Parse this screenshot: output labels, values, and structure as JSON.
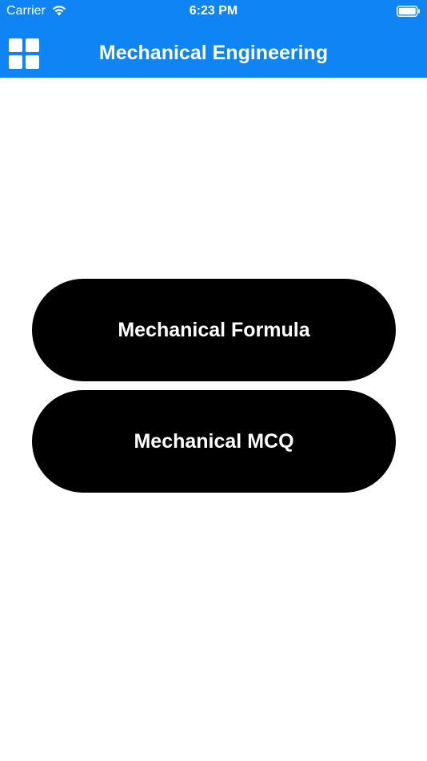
{
  "status_bar": {
    "carrier": "Carrier",
    "time": "6:23 PM",
    "icons": [
      "wifi-icon",
      "battery-icon"
    ]
  },
  "nav_bar": {
    "title": "Mechanical Engineering",
    "menu_icon": "grid-icon"
  },
  "main": {
    "buttons": [
      {
        "label": "Mechanical Formula"
      },
      {
        "label": "Mechanical MCQ"
      }
    ]
  },
  "colors": {
    "header": "#0F84F4",
    "button_bg": "#000000",
    "button_text": "#FFFFFF",
    "background": "#FFFFFF"
  }
}
